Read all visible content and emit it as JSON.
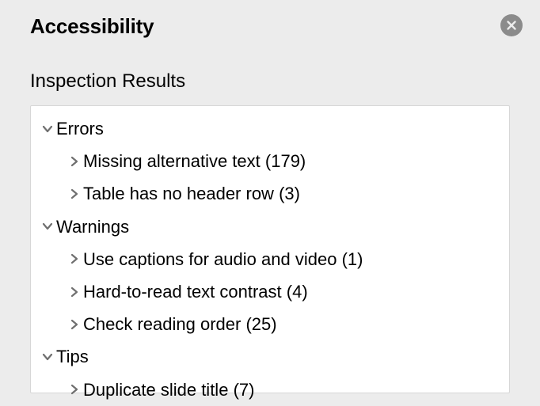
{
  "header": {
    "title": "Accessibility"
  },
  "subhead": "Inspection Results",
  "categories": [
    {
      "label": "Errors"
    },
    {
      "label": "Warnings"
    },
    {
      "label": "Tips"
    }
  ],
  "items": {
    "errors": [
      {
        "label": "Missing alternative text",
        "count": "(179)"
      },
      {
        "label": "Table has no header row",
        "count": "(3)"
      }
    ],
    "warnings": [
      {
        "label": "Use captions for audio and video",
        "count": "(1)"
      },
      {
        "label": "Hard-to-read text contrast",
        "count": "(4)"
      },
      {
        "label": "Check reading order",
        "count": "(25)"
      }
    ],
    "tips": [
      {
        "label": "Duplicate slide title",
        "count": "(7)"
      }
    ]
  }
}
